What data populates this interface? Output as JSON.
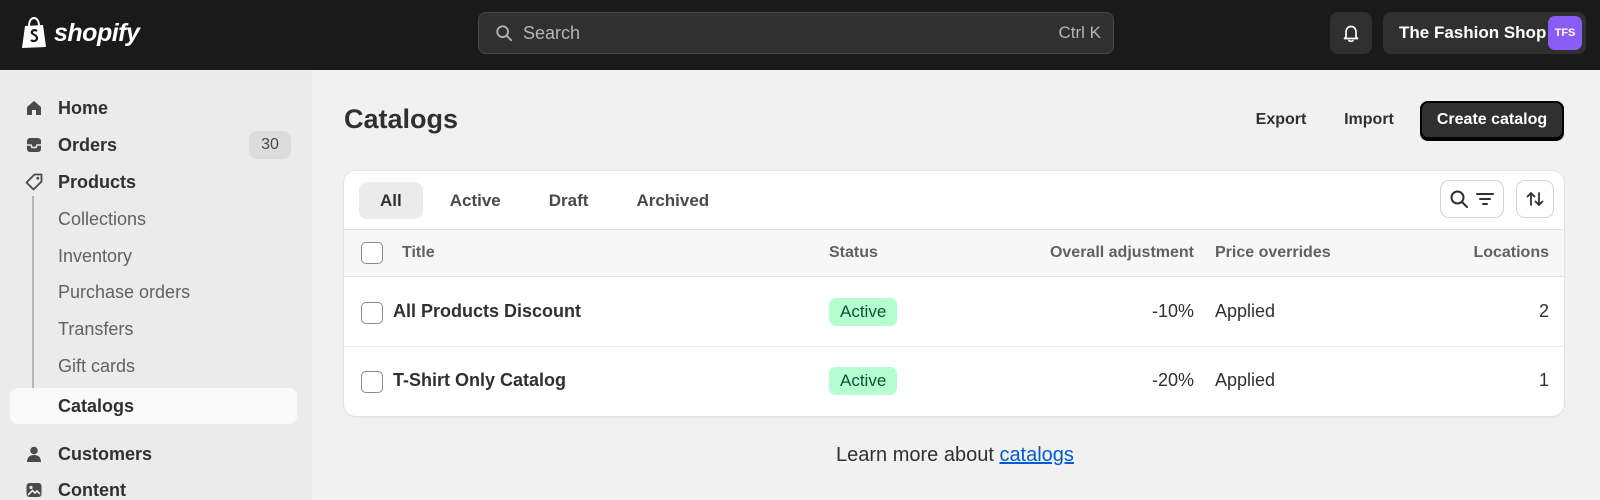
{
  "topbar": {
    "logo_text": "shopify",
    "search_placeholder": "Search",
    "search_shortcut": "Ctrl K",
    "store_name": "The Fashion Shop",
    "avatar_initials": "TFS"
  },
  "sidebar": {
    "items": [
      {
        "label": "Home",
        "icon": "home-icon"
      },
      {
        "label": "Orders",
        "icon": "inbox-icon",
        "badge": "30"
      },
      {
        "label": "Products",
        "icon": "tag-icon"
      },
      {
        "label": "Collections",
        "sub": true
      },
      {
        "label": "Inventory",
        "sub": true
      },
      {
        "label": "Purchase orders",
        "sub": true
      },
      {
        "label": "Transfers",
        "sub": true
      },
      {
        "label": "Gift cards",
        "sub": true
      },
      {
        "label": "Catalogs",
        "sub": true,
        "active": true
      },
      {
        "label": "Customers",
        "icon": "person-icon"
      },
      {
        "label": "Content",
        "icon": "image-icon"
      }
    ]
  },
  "page": {
    "title": "Catalogs",
    "export_label": "Export",
    "import_label": "Import",
    "create_label": "Create catalog"
  },
  "tabs": [
    "All",
    "Active",
    "Draft",
    "Archived"
  ],
  "table": {
    "headers": {
      "title": "Title",
      "status": "Status",
      "adjustment": "Overall adjustment",
      "overrides": "Price overrides",
      "locations": "Locations"
    },
    "rows": [
      {
        "title": "All Products Discount",
        "status": "Active",
        "adjustment": "-10%",
        "overrides": "Applied",
        "locations": "2"
      },
      {
        "title": "T-Shirt Only Catalog",
        "status": "Active",
        "adjustment": "-20%",
        "overrides": "Applied",
        "locations": "1"
      }
    ]
  },
  "footer": {
    "learn_prefix": "Learn more about ",
    "learn_link": "catalogs"
  },
  "colors": {
    "topbar_bg": "#1a1a1a",
    "primary_button": "#303030",
    "active_badge_bg": "#b4fed2",
    "active_badge_text": "#0c5132",
    "link": "#005bd3",
    "avatar": "#8a5cf6"
  }
}
